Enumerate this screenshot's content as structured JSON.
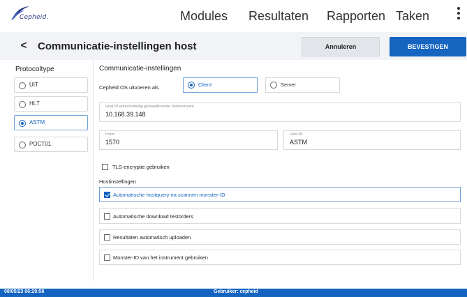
{
  "brand": {
    "logo_text": "Cepheid."
  },
  "nav": {
    "modules": "Modules",
    "resultaten": "Resultaten",
    "rapporten": "Rapporten",
    "taken": "Taken",
    "menu_icon": "kebab-menu-icon"
  },
  "header": {
    "back_icon": "<",
    "title": "Communicatie-instellingen host",
    "cancel_label": "Annuleren",
    "confirm_label": "BEVESTIGEN"
  },
  "protocol": {
    "heading": "Protocoltype",
    "options": [
      {
        "label": "UIT",
        "selected": false
      },
      {
        "label": "HL7",
        "selected": false
      },
      {
        "label": "ASTM",
        "selected": true
      },
      {
        "label": "POCT01",
        "selected": false
      }
    ]
  },
  "comm": {
    "heading": "Communicatie-instellingen",
    "os_label": "Cepheid OS uitvoeren als",
    "os_options": [
      {
        "label": "Client",
        "selected": true
      },
      {
        "label": "Server",
        "selected": false
      }
    ],
    "host_ip": {
      "label": "Host IP-adres/volledig gekwalificeerde domeinnaam",
      "value": "10.168.39.148"
    },
    "port": {
      "label": "Poort",
      "value": "1570"
    },
    "host_id": {
      "label": "Host-ID",
      "value": "ASTM"
    },
    "tls": {
      "label": "TLS-encryptie gebruiken",
      "checked": false
    }
  },
  "host_settings": {
    "heading": "Hostinstellingen",
    "options": [
      {
        "label": "Automatische hostquery na scannen monster-ID",
        "checked": true
      },
      {
        "label": "Automatische download testorders",
        "checked": false
      },
      {
        "label": "Resultaten automatisch uploaden",
        "checked": false
      },
      {
        "label": "Monster-ID van het instrument gebruiken",
        "checked": false
      }
    ]
  },
  "footer": {
    "timestamp": "08/05/23 06:29:58",
    "user": "Gebruiker: cepheid"
  },
  "colors": {
    "accent": "#1565c0",
    "header_bg": "#f1f3f6",
    "cancel_bg": "#e2e5ea"
  }
}
